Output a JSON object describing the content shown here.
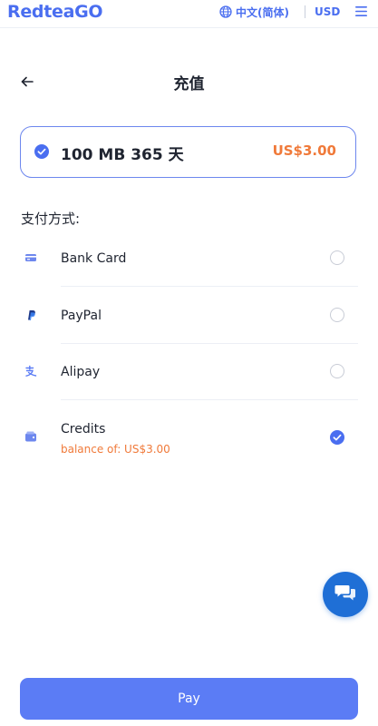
{
  "header": {
    "logo": "RedteaGO",
    "language": "中文(简体)",
    "currency": "USD"
  },
  "page": {
    "title": "充值"
  },
  "plan": {
    "name": "100 MB 365 天",
    "price": "US$3.00"
  },
  "payment": {
    "section_label": "支付方式:",
    "methods": [
      {
        "label": "Bank Card",
        "icon": "bank-card-icon",
        "selected": false
      },
      {
        "label": "PayPal",
        "icon": "paypal-icon",
        "selected": false
      },
      {
        "label": "Alipay",
        "icon": "alipay-icon",
        "selected": false
      },
      {
        "label": "Credits",
        "sublabel": "balance of: US$3.00",
        "icon": "wallet-icon",
        "selected": true
      }
    ]
  },
  "actions": {
    "pay_label": "Pay"
  },
  "colors": {
    "brand": "#4a6ef0",
    "price": "#f07a3a",
    "pay_button": "#5b7cf5",
    "chat_button": "#1f6fd6"
  }
}
